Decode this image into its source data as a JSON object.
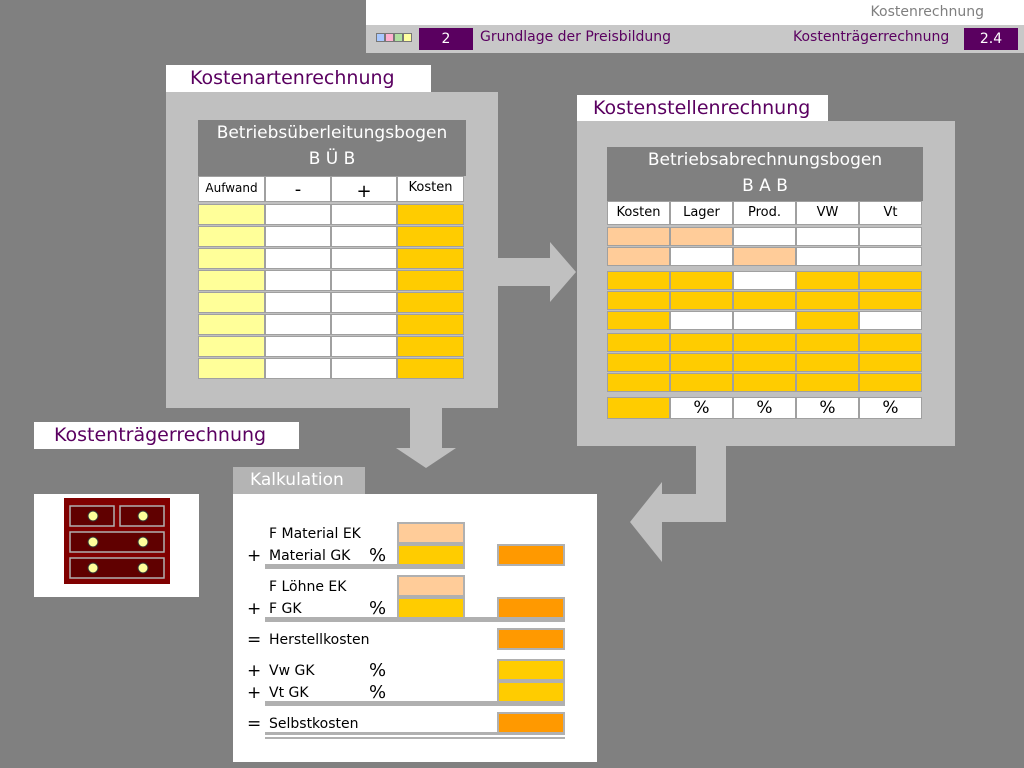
{
  "header": {
    "title": "Kostenrechnung",
    "chapter_number": "2",
    "chapter_title": "Grundlage der Preisbildung",
    "section_title": "Kostenträgerrechnung",
    "section_number": "2.4"
  },
  "colors": {
    "background": "#808080",
    "panel": "#c0c0c0",
    "accent": "#5a0060",
    "light_yellow": "#ffff99",
    "gold": "#ffcc00",
    "peach": "#ffcc99",
    "orange": "#ff9900"
  },
  "kostenarten": {
    "label": "Kostenartenrechnung",
    "table_title": "Betriebsüberleitungsbogen",
    "table_abbrev": "B Ü B",
    "columns": [
      "Aufwand",
      "-",
      "+",
      "Kosten"
    ]
  },
  "kostenstellen": {
    "label": "Kostenstellenrechnung",
    "table_title": "Betriebsabrechnungsbogen",
    "table_abbrev": "B A B",
    "columns": [
      "Kosten",
      "Lager",
      "Prod.",
      "VW",
      "Vt"
    ],
    "percent_row": [
      "%",
      "%",
      "%",
      "%"
    ]
  },
  "kostentraeger": {
    "label": "Kostenträgerrechnung"
  },
  "kalkulation": {
    "title": "Kalkulation",
    "rows": [
      {
        "op": "",
        "label": "F Material EK",
        "pct": ""
      },
      {
        "op": "+",
        "label": "Material GK",
        "pct": "%"
      },
      {
        "op": "",
        "label": "F Löhne EK",
        "pct": ""
      },
      {
        "op": "+",
        "label": "F GK",
        "pct": "%"
      },
      {
        "op": "=",
        "label": "Herstellkosten",
        "pct": ""
      },
      {
        "op": "+",
        "label": "Vw GK",
        "pct": "%"
      },
      {
        "op": "+",
        "label": "Vt GK",
        "pct": "%"
      },
      {
        "op": "=",
        "label": "Selbstkosten",
        "pct": ""
      }
    ]
  }
}
